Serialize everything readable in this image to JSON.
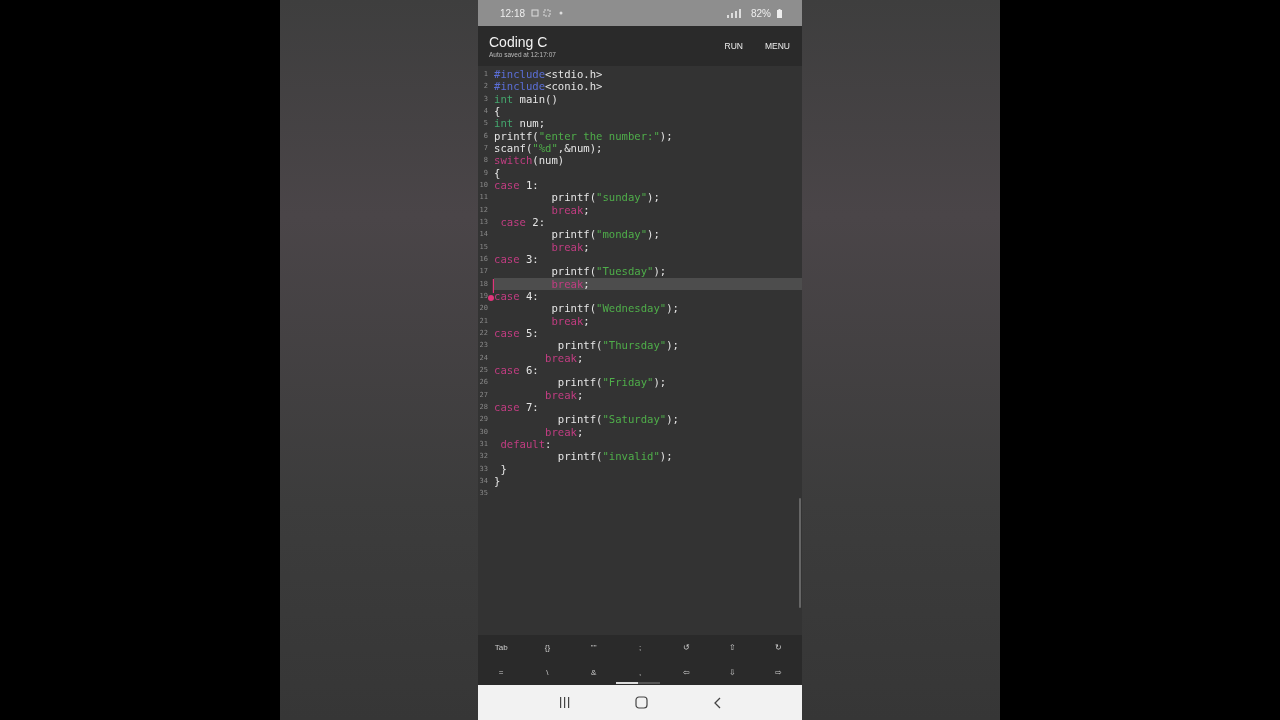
{
  "status_bar": {
    "time": "12:18",
    "battery": "82%"
  },
  "app_bar": {
    "title": "Coding C",
    "subtitle": "Auto saved at 12:17:07",
    "actions": [
      "RUN",
      "MENU"
    ]
  },
  "editor": {
    "lines": [
      {
        "number": "1",
        "current": false,
        "tokens": [
          {
            "kind": "preprocessor",
            "text": "#include"
          },
          {
            "kind": "plain",
            "text": "<stdio.h>"
          }
        ]
      },
      {
        "number": "2",
        "current": false,
        "tokens": [
          {
            "kind": "preprocessor",
            "text": "#include"
          },
          {
            "kind": "plain",
            "text": "<conio.h>"
          }
        ]
      },
      {
        "number": "3",
        "current": false,
        "tokens": [
          {
            "kind": "type",
            "text": "int"
          },
          {
            "kind": "plain",
            "text": " main()"
          }
        ]
      },
      {
        "number": "4",
        "current": false,
        "tokens": [
          {
            "kind": "plain",
            "text": "{"
          }
        ]
      },
      {
        "number": "5",
        "current": false,
        "tokens": [
          {
            "kind": "type",
            "text": "int"
          },
          {
            "kind": "plain",
            "text": " num;"
          }
        ]
      },
      {
        "number": "6",
        "current": false,
        "tokens": [
          {
            "kind": "plain",
            "text": "printf("
          },
          {
            "kind": "string",
            "text": "\"enter the number:\""
          },
          {
            "kind": "plain",
            "text": ");"
          }
        ]
      },
      {
        "number": "7",
        "current": false,
        "tokens": [
          {
            "kind": "plain",
            "text": "scanf("
          },
          {
            "kind": "string",
            "text": "\"%d\""
          },
          {
            "kind": "plain",
            "text": ",&num);"
          }
        ]
      },
      {
        "number": "8",
        "current": false,
        "tokens": [
          {
            "kind": "keyword",
            "text": "switch"
          },
          {
            "kind": "plain",
            "text": "(num)"
          }
        ]
      },
      {
        "number": "9",
        "current": false,
        "tokens": [
          {
            "kind": "plain",
            "text": "{"
          }
        ]
      },
      {
        "number": "10",
        "current": false,
        "tokens": [
          {
            "kind": "keyword",
            "text": "case"
          },
          {
            "kind": "plain",
            "text": " 1:"
          }
        ]
      },
      {
        "number": "11",
        "current": false,
        "tokens": [
          {
            "kind": "plain",
            "text": "         printf("
          },
          {
            "kind": "string",
            "text": "\"sunday\""
          },
          {
            "kind": "plain",
            "text": ");"
          }
        ]
      },
      {
        "number": "12",
        "current": false,
        "tokens": [
          {
            "kind": "keyword",
            "text": "         break"
          },
          {
            "kind": "plain",
            "text": ";"
          }
        ]
      },
      {
        "number": "13",
        "current": false,
        "tokens": [
          {
            "kind": "keyword",
            "text": " case"
          },
          {
            "kind": "plain",
            "text": " 2:"
          }
        ]
      },
      {
        "number": "14",
        "current": false,
        "tokens": [
          {
            "kind": "plain",
            "text": "         printf("
          },
          {
            "kind": "string",
            "text": "\"monday\""
          },
          {
            "kind": "plain",
            "text": ");"
          }
        ]
      },
      {
        "number": "15",
        "current": false,
        "tokens": [
          {
            "kind": "keyword",
            "text": "         break"
          },
          {
            "kind": "plain",
            "text": ";"
          }
        ]
      },
      {
        "number": "16",
        "current": false,
        "tokens": [
          {
            "kind": "keyword",
            "text": "case"
          },
          {
            "kind": "plain",
            "text": " 3:"
          }
        ]
      },
      {
        "number": "17",
        "current": false,
        "tokens": [
          {
            "kind": "plain",
            "text": "         printf("
          },
          {
            "kind": "string",
            "text": "\"Tuesday\""
          },
          {
            "kind": "plain",
            "text": ");"
          }
        ]
      },
      {
        "number": "18",
        "current": true,
        "tokens": [
          {
            "kind": "keyword",
            "text": "         break"
          },
          {
            "kind": "plain",
            "text": ";"
          }
        ]
      },
      {
        "number": "19",
        "current": false,
        "tokens": [
          {
            "kind": "keyword",
            "text": "case"
          },
          {
            "kind": "plain",
            "text": " 4:"
          }
        ]
      },
      {
        "number": "20",
        "current": false,
        "tokens": [
          {
            "kind": "plain",
            "text": "         printf("
          },
          {
            "kind": "string",
            "text": "\"Wednesday\""
          },
          {
            "kind": "plain",
            "text": ");"
          }
        ]
      },
      {
        "number": "21",
        "current": false,
        "tokens": [
          {
            "kind": "keyword",
            "text": "         break"
          },
          {
            "kind": "plain",
            "text": ";"
          }
        ]
      },
      {
        "number": "22",
        "current": false,
        "tokens": [
          {
            "kind": "keyword",
            "text": "case"
          },
          {
            "kind": "plain",
            "text": " 5:"
          }
        ]
      },
      {
        "number": "23",
        "current": false,
        "tokens": [
          {
            "kind": "plain",
            "text": "          printf("
          },
          {
            "kind": "string",
            "text": "\"Thursday\""
          },
          {
            "kind": "plain",
            "text": ");"
          }
        ]
      },
      {
        "number": "24",
        "current": false,
        "tokens": [
          {
            "kind": "keyword",
            "text": "        break"
          },
          {
            "kind": "plain",
            "text": ";"
          }
        ]
      },
      {
        "number": "25",
        "current": false,
        "tokens": [
          {
            "kind": "keyword",
            "text": "case"
          },
          {
            "kind": "plain",
            "text": " 6:"
          }
        ]
      },
      {
        "number": "26",
        "current": false,
        "tokens": [
          {
            "kind": "plain",
            "text": "          printf("
          },
          {
            "kind": "string",
            "text": "\"Friday\""
          },
          {
            "kind": "plain",
            "text": ");"
          }
        ]
      },
      {
        "number": "27",
        "current": false,
        "tokens": [
          {
            "kind": "keyword",
            "text": "        break"
          },
          {
            "kind": "plain",
            "text": ";"
          }
        ]
      },
      {
        "number": "28",
        "current": false,
        "tokens": [
          {
            "kind": "keyword",
            "text": "case"
          },
          {
            "kind": "plain",
            "text": " 7:"
          }
        ]
      },
      {
        "number": "29",
        "current": false,
        "tokens": [
          {
            "kind": "plain",
            "text": "          printf("
          },
          {
            "kind": "string",
            "text": "\"Saturday\""
          },
          {
            "kind": "plain",
            "text": ");"
          }
        ]
      },
      {
        "number": "30",
        "current": false,
        "tokens": [
          {
            "kind": "keyword",
            "text": "        break"
          },
          {
            "kind": "plain",
            "text": ";"
          }
        ]
      },
      {
        "number": "31",
        "current": false,
        "tokens": [
          {
            "kind": "keyword",
            "text": " default"
          },
          {
            "kind": "plain",
            "text": ":"
          }
        ]
      },
      {
        "number": "32",
        "current": false,
        "tokens": [
          {
            "kind": "plain",
            "text": "          printf("
          },
          {
            "kind": "string",
            "text": "\"invalid\""
          },
          {
            "kind": "plain",
            "text": ");"
          }
        ]
      },
      {
        "number": "33",
        "current": false,
        "tokens": [
          {
            "kind": "plain",
            "text": " }"
          }
        ]
      },
      {
        "number": "34",
        "current": false,
        "tokens": [
          {
            "kind": "plain",
            "text": "}"
          }
        ]
      },
      {
        "number": "35"
      }
    ]
  },
  "symbol_bar": {
    "rows": [
      [
        "Tab",
        "{}",
        "\"\"",
        ";",
        "↺",
        "⇧",
        "↻"
      ],
      [
        "=",
        "\\",
        "&",
        ",",
        "⇦",
        "⇩",
        "⇨"
      ]
    ]
  }
}
